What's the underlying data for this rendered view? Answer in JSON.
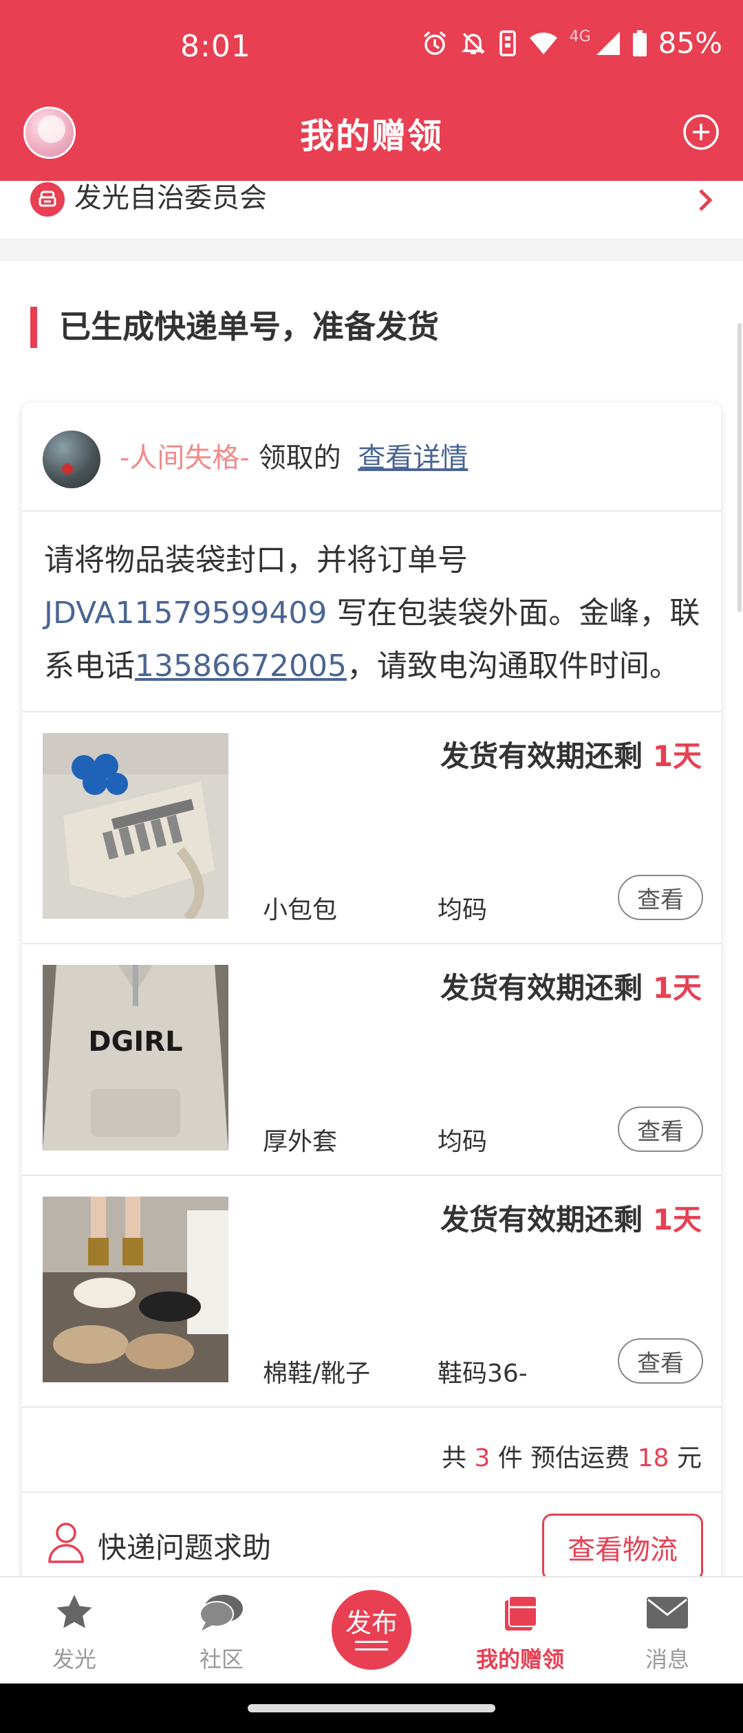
{
  "status": {
    "time": "8:01",
    "net_label": "4G",
    "battery": "85%"
  },
  "header": {
    "title": "我的赠领"
  },
  "org": {
    "label": "发光自治委员会"
  },
  "section": {
    "title": "已生成快递单号，准备发货"
  },
  "card": {
    "giver_name": "-人间失格-",
    "received_text": "领取的",
    "detail_link": "查看详情",
    "notice_part1": "请将物品装袋封口，并将订单号 ",
    "order_no": "JDVA11579599409",
    "notice_part2": " 写在包装袋外面。金峰，联系电话",
    "phone": "13586672005",
    "notice_part3": "，请致电沟通取件时间。",
    "items": [
      {
        "days_prefix": "发货有效期还剩 ",
        "days": "1天",
        "name": "小包包",
        "size": "均码",
        "btn": "查看"
      },
      {
        "days_prefix": "发货有效期还剩 ",
        "days": "1天",
        "name": "厚外套",
        "size": "均码",
        "btn": "查看"
      },
      {
        "days_prefix": "发货有效期还剩 ",
        "days": "1天",
        "name": "棉鞋/靴子",
        "size": "鞋码36-",
        "btn": "查看"
      }
    ],
    "summary_pre": "共 ",
    "summary_count": "3",
    "summary_mid": " 件 预估运费 ",
    "summary_fee": "18",
    "summary_post": " 元",
    "help_label": "快递问题求助",
    "logistics_btn": "查看物流"
  },
  "bottom_nav": {
    "tabs": [
      {
        "label": "发光",
        "icon": "star-icon"
      },
      {
        "label": "社区",
        "icon": "chat-icon"
      },
      {
        "label": "发布",
        "icon": "publish-icon"
      },
      {
        "label": "我的赠领",
        "icon": "gift-box-icon"
      },
      {
        "label": "消息",
        "icon": "mail-icon"
      }
    ]
  },
  "colors": {
    "accent": "#e83f52",
    "link": "#4a6594",
    "text": "#333333"
  }
}
